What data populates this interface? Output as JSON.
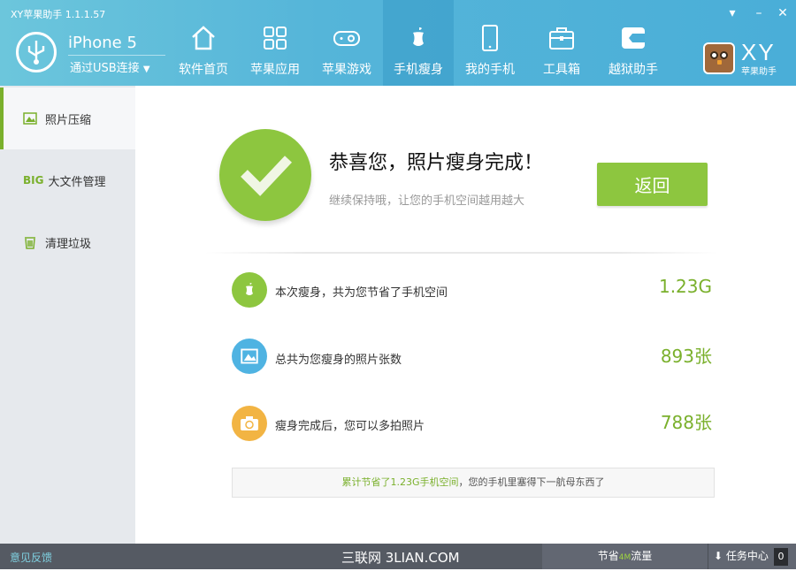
{
  "app": {
    "title": "XY苹果助手 1.1.1.57"
  },
  "device": {
    "name": "iPhone 5",
    "connection": "通过USB连接"
  },
  "nav": [
    {
      "label": "软件首页",
      "icon": "home-icon"
    },
    {
      "label": "苹果应用",
      "icon": "apps-grid-icon"
    },
    {
      "label": "苹果游戏",
      "icon": "gamepad-icon"
    },
    {
      "label": "手机瘦身",
      "icon": "slim-apple-icon",
      "active": true
    },
    {
      "label": "我的手机",
      "icon": "tablet-icon"
    },
    {
      "label": "工具箱",
      "icon": "toolbox-icon"
    },
    {
      "label": "越狱助手",
      "icon": "jailbreak-icon"
    }
  ],
  "brand": {
    "logo": "XY",
    "sub": "苹果助手"
  },
  "sidebar": {
    "items": [
      {
        "label": "照片压缩",
        "icon": "photo-icon"
      },
      {
        "label": "大文件管理",
        "badge": "BIG"
      },
      {
        "label": "清理垃圾",
        "icon": "trash-icon"
      }
    ]
  },
  "main": {
    "title": "恭喜您，照片瘦身完成！",
    "subtitle": "继续保持哦，让您的手机空间越用越大",
    "back_label": "返回",
    "rows": [
      {
        "text": "本次瘦身，共为您节省了手机空间",
        "value": "1.23G"
      },
      {
        "text": "总共为您瘦身的照片张数",
        "value": "893张"
      },
      {
        "text": "瘦身完成后，您可以多拍照片",
        "value": "788张"
      }
    ],
    "notice_green": "累计节省了1.23G手机空间",
    "notice_rest": "，您的手机里塞得下一航母东西了"
  },
  "footer": {
    "feedback": "意见反馈",
    "watermark": "三联网 3LIAN.COM",
    "save_prefix": "节省",
    "save_value": "4M",
    "save_suffix": "流量",
    "tasks": "任务中心",
    "task_count": "0"
  },
  "colors": {
    "accent": "#8dc63f",
    "header": "#4aaed8",
    "value": "#7ab02c"
  }
}
